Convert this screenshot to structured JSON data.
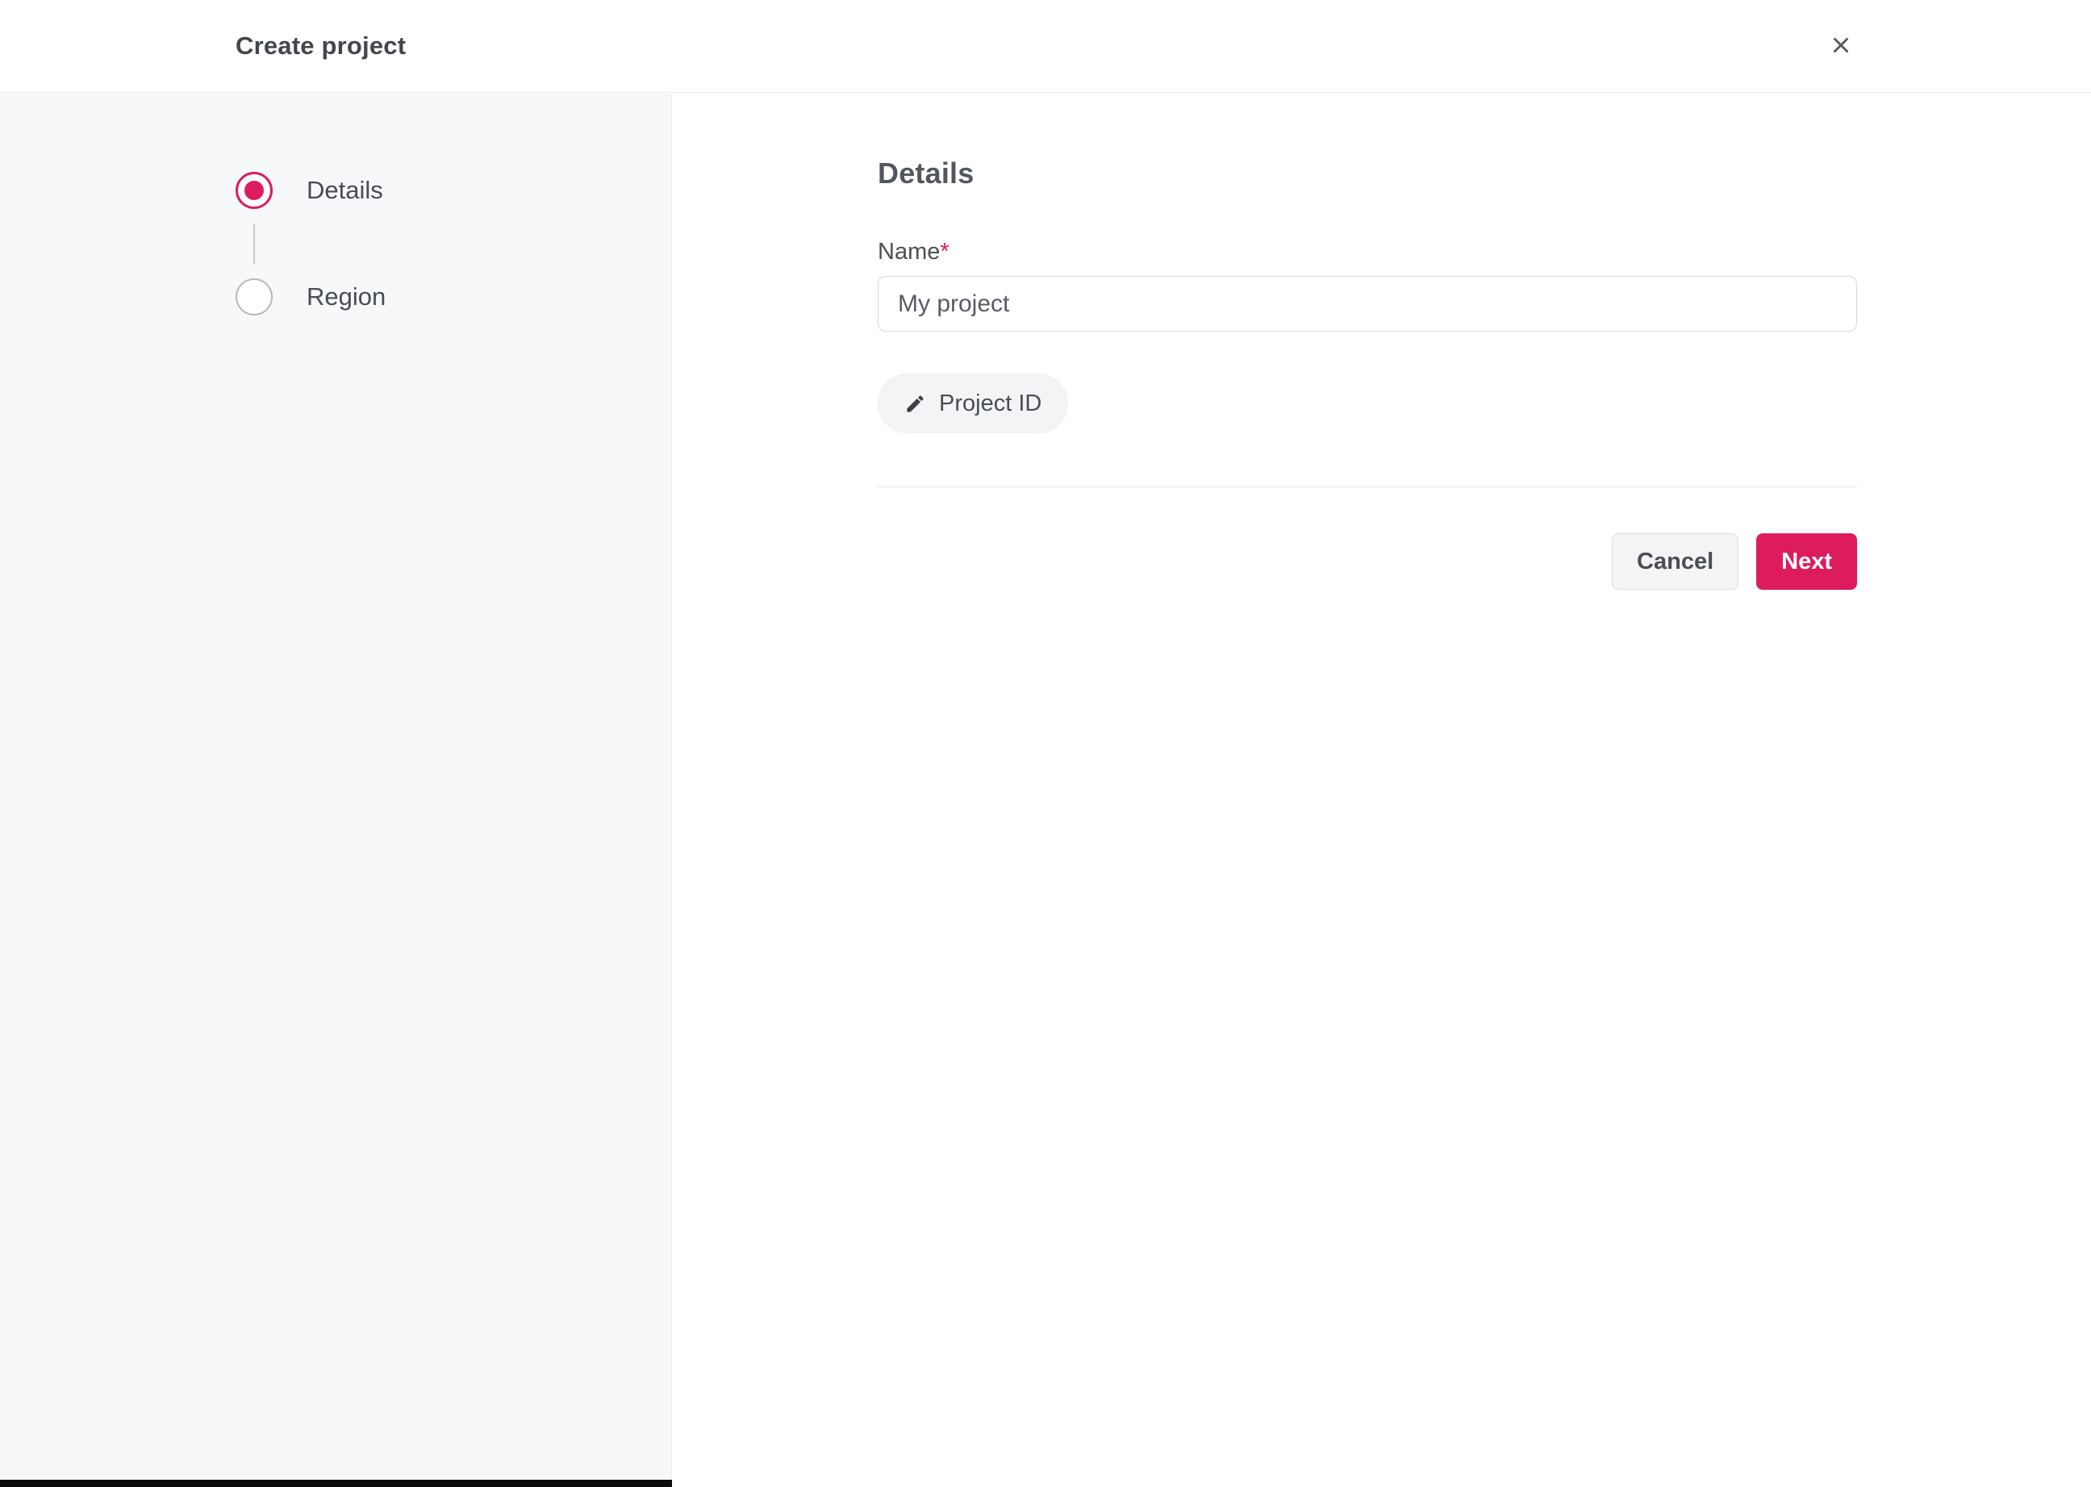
{
  "window": {
    "title": "Create project"
  },
  "stepper": {
    "steps": [
      {
        "label": "Details",
        "state": "active"
      },
      {
        "label": "Region",
        "state": "inactive"
      }
    ]
  },
  "form": {
    "heading": "Details",
    "name_label": "Name",
    "required_marker": "*",
    "name_value": "My project",
    "project_id_label": "Project ID"
  },
  "footer": {
    "cancel_label": "Cancel",
    "next_label": "Next"
  },
  "icons": {
    "close": "close-icon",
    "edit": "pencil-icon"
  },
  "colors": {
    "accent": "#dd1c5e",
    "sidebar_bg": "#f7f8f9",
    "border": "#ececee",
    "text_primary": "#43464b",
    "text_secondary": "#4c5056"
  }
}
